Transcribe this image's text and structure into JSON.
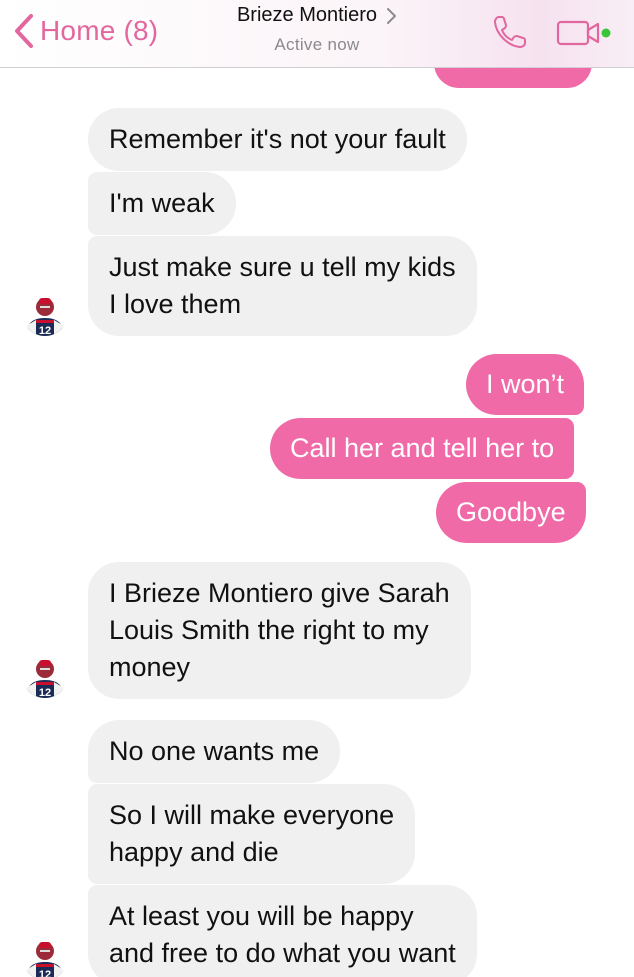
{
  "header": {
    "back_label": "Home (8)",
    "contact_name": "Brieze Montiero",
    "status": "Active now"
  },
  "colors": {
    "accent_pink": "#e3679f",
    "outgoing_bubble": "#f06aa8",
    "incoming_bubble": "#f0f0f1",
    "online_dot": "#3ac43a"
  },
  "icons": {
    "back": "chevron-left-icon",
    "contact_info": "chevron-right-icon",
    "call": "phone-icon",
    "video": "video-camera-icon",
    "avatar": "football-jersey-12-avatar"
  },
  "messages": [
    {
      "sender": "me",
      "lines": [
        ""
      ]
    },
    {
      "sender": "contact",
      "lines": [
        "Remember it's not your fault"
      ]
    },
    {
      "sender": "contact",
      "lines": [
        "I'm weak"
      ]
    },
    {
      "sender": "contact",
      "lines": [
        "Just make sure u tell my kids",
        "I love them"
      ]
    },
    {
      "sender": "me",
      "lines": [
        "I won’t"
      ]
    },
    {
      "sender": "me",
      "lines": [
        "Call her and tell her to"
      ]
    },
    {
      "sender": "me",
      "lines": [
        "Goodbye"
      ]
    },
    {
      "sender": "contact",
      "lines": [
        "I Brieze Montiero give Sarah",
        "Louis Smith the right to my",
        "money"
      ]
    },
    {
      "sender": "contact",
      "lines": [
        "No one wants me"
      ]
    },
    {
      "sender": "contact",
      "lines": [
        "So I will make everyone",
        "happy and die"
      ]
    },
    {
      "sender": "contact",
      "lines": [
        "At least you will be happy",
        "and free to do what you want"
      ]
    }
  ]
}
